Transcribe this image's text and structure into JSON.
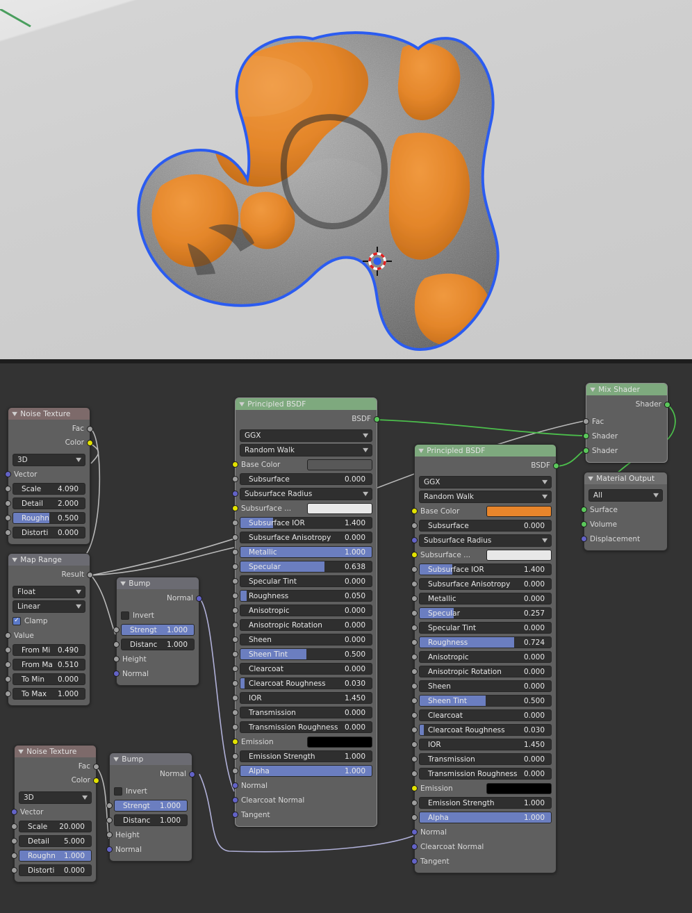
{
  "app": {
    "editor": "blender-shader-editor"
  },
  "viewport": {
    "background_color": "#d2d2d2",
    "object_outline_color": "#2b5cf0",
    "orange_material_color": "#e8852b",
    "grey_material_color": "#8a8a8a",
    "cursor": "3d-cursor"
  },
  "nodes": {
    "noise_top": {
      "title": "Noise Texture",
      "header_color": "#7d6a6a",
      "outputs": [
        {
          "label": "Fac",
          "socket": "grey"
        },
        {
          "label": "Color",
          "socket": "yellow"
        }
      ],
      "dimension": "3D",
      "vector_label": "Vector",
      "props": [
        {
          "label": "Scale",
          "value": "4.090",
          "fill": 0
        },
        {
          "label": "Detail",
          "value": "2.000",
          "fill": 0
        },
        {
          "label": "Roughn",
          "value": "0.500",
          "fill": 50
        },
        {
          "label": "Distorti",
          "value": "0.000",
          "fill": 0
        }
      ]
    },
    "map_range": {
      "title": "Map Range",
      "header_color": "#6b6b72",
      "output_label": "Result",
      "data_type": "Float",
      "interpolation": "Linear",
      "clamp_label": "Clamp",
      "clamp_checked": true,
      "value_label": "Value",
      "props": [
        {
          "label": "From Mi",
          "value": "0.490"
        },
        {
          "label": "From Ma",
          "value": "0.510"
        },
        {
          "label": "To Min",
          "value": "0.000"
        },
        {
          "label": "To Max",
          "value": "1.000"
        }
      ]
    },
    "bump_top": {
      "title": "Bump",
      "header_color": "#6b6b72",
      "output_label": "Normal",
      "invert_label": "Invert",
      "invert_checked": false,
      "props": [
        {
          "label": "Strengt",
          "value": "1.000",
          "fill": 100
        },
        {
          "label": "Distanc",
          "value": "1.000",
          "fill": 0
        }
      ],
      "inputs": [
        "Height",
        "Normal"
      ]
    },
    "noise_bottom": {
      "title": "Noise Texture",
      "header_color": "#7d6a6a",
      "outputs": [
        {
          "label": "Fac",
          "socket": "grey"
        },
        {
          "label": "Color",
          "socket": "yellow"
        }
      ],
      "dimension": "3D",
      "vector_label": "Vector",
      "props": [
        {
          "label": "Scale",
          "value": "20.000",
          "fill": 0
        },
        {
          "label": "Detail",
          "value": "5.000",
          "fill": 0
        },
        {
          "label": "Roughn",
          "value": "1.000",
          "fill": 100
        },
        {
          "label": "Distorti",
          "value": "0.000",
          "fill": 0
        }
      ]
    },
    "bump_bottom": {
      "title": "Bump",
      "header_color": "#6b6b72",
      "output_label": "Normal",
      "invert_label": "Invert",
      "invert_checked": false,
      "props": [
        {
          "label": "Strengt",
          "value": "1.000",
          "fill": 100
        },
        {
          "label": "Distanc",
          "value": "1.000",
          "fill": 0
        }
      ],
      "inputs": [
        "Height",
        "Normal"
      ]
    },
    "bsdf_left": {
      "title": "Principled BSDF",
      "header_color": "#7ea97e",
      "output_label": "BSDF",
      "distribution": "GGX",
      "subsurface_method": "Random Walk",
      "base_color_label": "Base Color",
      "base_color": "#585858",
      "subsurface_radius_label": "Subsurface Radius",
      "subsurface_color_label": "Subsurface ...",
      "subsurface_color": "#e8e8e8",
      "emission_label": "Emission",
      "emission_color": "#000000",
      "props": [
        {
          "label": "Subsurface",
          "value": "0.000",
          "fill": 0
        },
        {
          "label": "Subsurface IOR",
          "value": "1.400",
          "fill": 25
        },
        {
          "label": "Subsurface Anisotropy",
          "value": "0.000",
          "fill": 0
        },
        {
          "label": "Metallic",
          "value": "1.000",
          "fill": 100
        },
        {
          "label": "Specular",
          "value": "0.638",
          "fill": 64
        },
        {
          "label": "Specular Tint",
          "value": "0.000",
          "fill": 0
        },
        {
          "label": "Roughness",
          "value": "0.050",
          "fill": 5
        },
        {
          "label": "Anisotropic",
          "value": "0.000",
          "fill": 0
        },
        {
          "label": "Anisotropic Rotation",
          "value": "0.000",
          "fill": 0
        },
        {
          "label": "Sheen",
          "value": "0.000",
          "fill": 0
        },
        {
          "label": "Sheen Tint",
          "value": "0.500",
          "fill": 50
        },
        {
          "label": "Clearcoat",
          "value": "0.000",
          "fill": 0
        },
        {
          "label": "Clearcoat Roughness",
          "value": "0.030",
          "fill": 3
        },
        {
          "label": "IOR",
          "value": "1.450",
          "fill": 0
        },
        {
          "label": "Transmission",
          "value": "0.000",
          "fill": 0
        },
        {
          "label": "Transmission Roughness",
          "value": "0.000",
          "fill": 0
        },
        {
          "label": "Emission Strength",
          "value": "1.000",
          "fill": 0
        },
        {
          "label": "Alpha",
          "value": "1.000",
          "fill": 100
        }
      ],
      "vector_inputs": [
        "Normal",
        "Clearcoat Normal",
        "Tangent"
      ]
    },
    "bsdf_right": {
      "title": "Principled BSDF",
      "header_color": "#7ea97e",
      "output_label": "BSDF",
      "distribution": "GGX",
      "subsurface_method": "Random Walk",
      "base_color_label": "Base Color",
      "base_color": "#e8852b",
      "subsurface_radius_label": "Subsurface Radius",
      "subsurface_color_label": "Subsurface ...",
      "subsurface_color": "#e8e8e8",
      "emission_label": "Emission",
      "emission_color": "#000000",
      "props": [
        {
          "label": "Subsurface",
          "value": "0.000",
          "fill": 0
        },
        {
          "label": "Subsurface IOR",
          "value": "1.400",
          "fill": 25
        },
        {
          "label": "Subsurface Anisotropy",
          "value": "0.000",
          "fill": 0
        },
        {
          "label": "Metallic",
          "value": "0.000",
          "fill": 0
        },
        {
          "label": "Specular",
          "value": "0.257",
          "fill": 26
        },
        {
          "label": "Specular Tint",
          "value": "0.000",
          "fill": 0
        },
        {
          "label": "Roughness",
          "value": "0.724",
          "fill": 72
        },
        {
          "label": "Anisotropic",
          "value": "0.000",
          "fill": 0
        },
        {
          "label": "Anisotropic Rotation",
          "value": "0.000",
          "fill": 0
        },
        {
          "label": "Sheen",
          "value": "0.000",
          "fill": 0
        },
        {
          "label": "Sheen Tint",
          "value": "0.500",
          "fill": 50
        },
        {
          "label": "Clearcoat",
          "value": "0.000",
          "fill": 0
        },
        {
          "label": "Clearcoat Roughness",
          "value": "0.030",
          "fill": 3
        },
        {
          "label": "IOR",
          "value": "1.450",
          "fill": 0
        },
        {
          "label": "Transmission",
          "value": "0.000",
          "fill": 0
        },
        {
          "label": "Transmission Roughness",
          "value": "0.000",
          "fill": 0
        },
        {
          "label": "Emission Strength",
          "value": "1.000",
          "fill": 0
        },
        {
          "label": "Alpha",
          "value": "1.000",
          "fill": 100
        }
      ],
      "vector_inputs": [
        "Normal",
        "Clearcoat Normal",
        "Tangent"
      ]
    },
    "mix_shader": {
      "title": "Mix Shader",
      "header_color": "#7ea97e",
      "output_label": "Shader",
      "inputs": [
        {
          "label": "Fac",
          "socket": "grey"
        },
        {
          "label": "Shader",
          "socket": "green"
        },
        {
          "label": "Shader",
          "socket": "green"
        }
      ]
    },
    "material_output": {
      "title": "Material Output",
      "header_color": "#6e6e6e",
      "target": "All",
      "inputs": [
        {
          "label": "Surface",
          "socket": "green"
        },
        {
          "label": "Volume",
          "socket": "green"
        },
        {
          "label": "Displacement",
          "socket": "purple"
        }
      ]
    }
  },
  "colors": {
    "editor_background": "#333333",
    "node_body": "#5f5f5f",
    "field_background": "#2f2f2f",
    "slider_fill": "#6b7ec0",
    "wire_shader": "#4cbf4c",
    "wire_value": "#b9b9b9",
    "wire_vector": "#b0b0d8"
  }
}
